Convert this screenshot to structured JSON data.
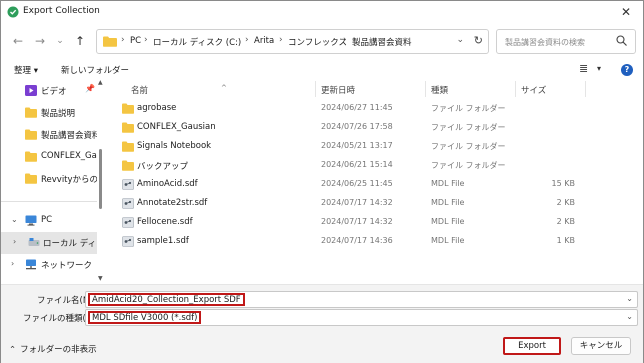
{
  "window": {
    "title": "Export Collection",
    "close_glyph": "✕"
  },
  "nav": {
    "back_glyph": "←",
    "forward_glyph": "→",
    "recent_glyph": "⌄",
    "up_glyph": "↑",
    "breadcrumb": [
      "PC",
      "ローカル ディスク (C:)",
      "Arita",
      "コンフレックス",
      "製品講習会資料"
    ],
    "breadcrumb_sep": "›",
    "dropdown_glyph": "⌄",
    "refresh_glyph": "↻",
    "search_placeholder": "製品講習会資料の検索"
  },
  "toolbar": {
    "organize": "整理 ▾",
    "new_folder": "新しいフォルダー",
    "view_glyph": "≣",
    "view_dd": "▾",
    "help": "?"
  },
  "sidebar": {
    "items": [
      {
        "label": "ビデオ",
        "pinned": true
      },
      {
        "label": "製品説明"
      },
      {
        "label": "製品講習会資料"
      },
      {
        "label": "CONFLEX_Gausian"
      },
      {
        "label": "Revvityからの資料"
      },
      {
        "label": "PC",
        "chevron": "⌄"
      },
      {
        "label": "ローカル ディスク",
        "chevron": "›"
      },
      {
        "label": "ネットワーク",
        "chevron": "›"
      }
    ],
    "pin_glyph": "📌"
  },
  "columns": {
    "name": "名前",
    "date": "更新日時",
    "type": "種類",
    "size": "サイズ",
    "sort_glyph": "^"
  },
  "files": [
    {
      "name": "agrobase",
      "date": "2024/06/27 11:45",
      "type": "ファイル フォルダー",
      "size": "",
      "icon": "folder-icon"
    },
    {
      "name": "CONFLEX_Gausian",
      "date": "2024/07/26 17:58",
      "type": "ファイル フォルダー",
      "size": "",
      "icon": "folder-icon"
    },
    {
      "name": "Signals Notebook",
      "date": "2024/05/21 13:17",
      "type": "ファイル フォルダー",
      "size": "",
      "icon": "folder-icon"
    },
    {
      "name": "バックアップ",
      "date": "2024/06/21 15:14",
      "type": "ファイル フォルダー",
      "size": "",
      "icon": "folder-icon"
    },
    {
      "name": "AminoAcid.sdf",
      "date": "2024/06/25 11:45",
      "type": "MDL File",
      "size": "15 KB",
      "icon": "sdf-file-icon"
    },
    {
      "name": "Annotate2str.sdf",
      "date": "2024/07/17 14:32",
      "type": "MDL File",
      "size": "2 KB",
      "icon": "sdf-file-icon"
    },
    {
      "name": "Fellocene.sdf",
      "date": "2024/07/17 14:32",
      "type": "MDL File",
      "size": "2 KB",
      "icon": "sdf-file-icon"
    },
    {
      "name": "sample1.sdf",
      "date": "2024/07/17 14:36",
      "type": "MDL File",
      "size": "1 KB",
      "icon": "sdf-file-icon"
    }
  ],
  "form": {
    "filename_label": "ファイル名(N):",
    "filename_value": "AmidAcid20_Collection_Export SDF",
    "filetype_label": "ファイルの種類(T):",
    "filetype_value": "MDL SDfile V3000 (*.sdf)",
    "dd_glyph": "⌄"
  },
  "footer": {
    "hide_folders": "フォルダーの非表示",
    "hide_caret": "⌃",
    "export": "Export",
    "cancel": "キャンセル"
  },
  "colors": {
    "folder": "#f4c542",
    "highlight_border": "#c01818",
    "accent": "#1f5fbf"
  }
}
